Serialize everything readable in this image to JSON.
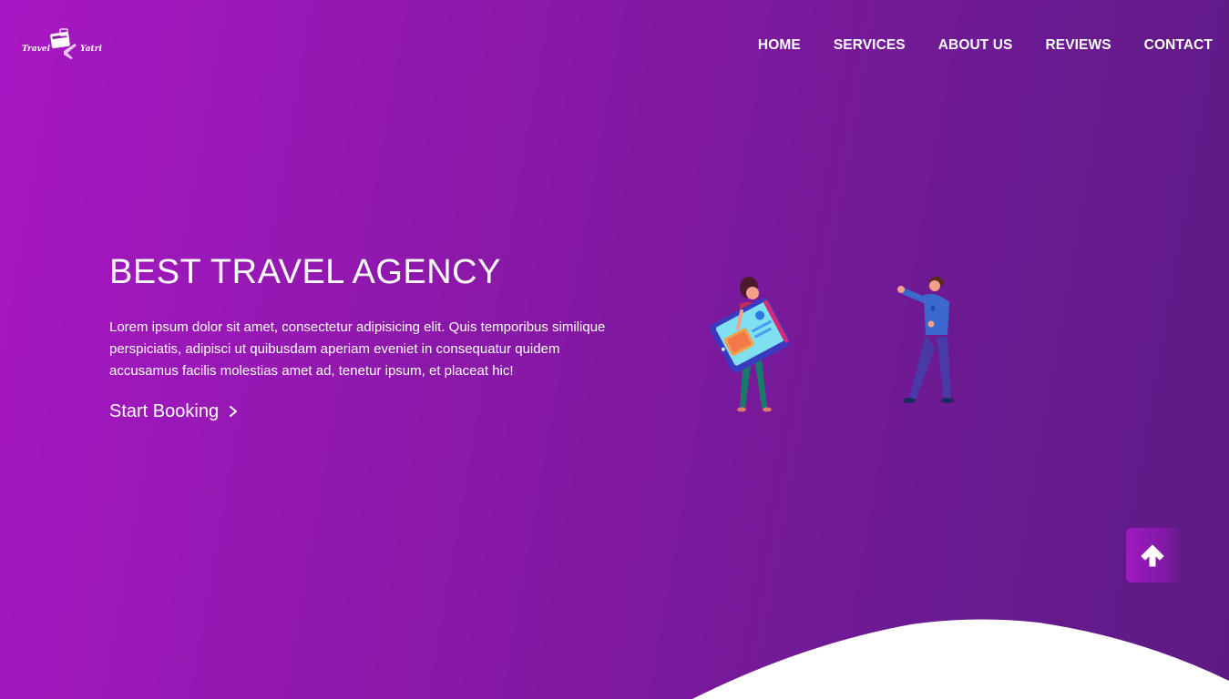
{
  "brand": {
    "logo_text_left": "Travel",
    "logo_text_right": "Yatri"
  },
  "nav": {
    "items": [
      "HOME",
      "SERVICES",
      "ABOUT US",
      "REVIEWS",
      "CONTACT"
    ]
  },
  "hero": {
    "title": "BEST TRAVEL AGENCY",
    "description": "Lorem ipsum dolor sit amet, consectetur adipisicing elit. Quis temporibus similique perspiciatis, adipisci ut quibusdam aperiam eveniet in consequatur quidem accusamus facilis molestias amet ad, tenetur ipsum, et placeat hic!",
    "cta_label": "Start Booking",
    "cta_icon": "chevron-right-icon"
  },
  "back_to_top": {
    "icon": "arrow-up-icon"
  },
  "colors": {
    "gradient_start": "#a817c4",
    "gradient_end": "#5d1a84",
    "text": "#ffffff",
    "wave": "#ffffff"
  }
}
